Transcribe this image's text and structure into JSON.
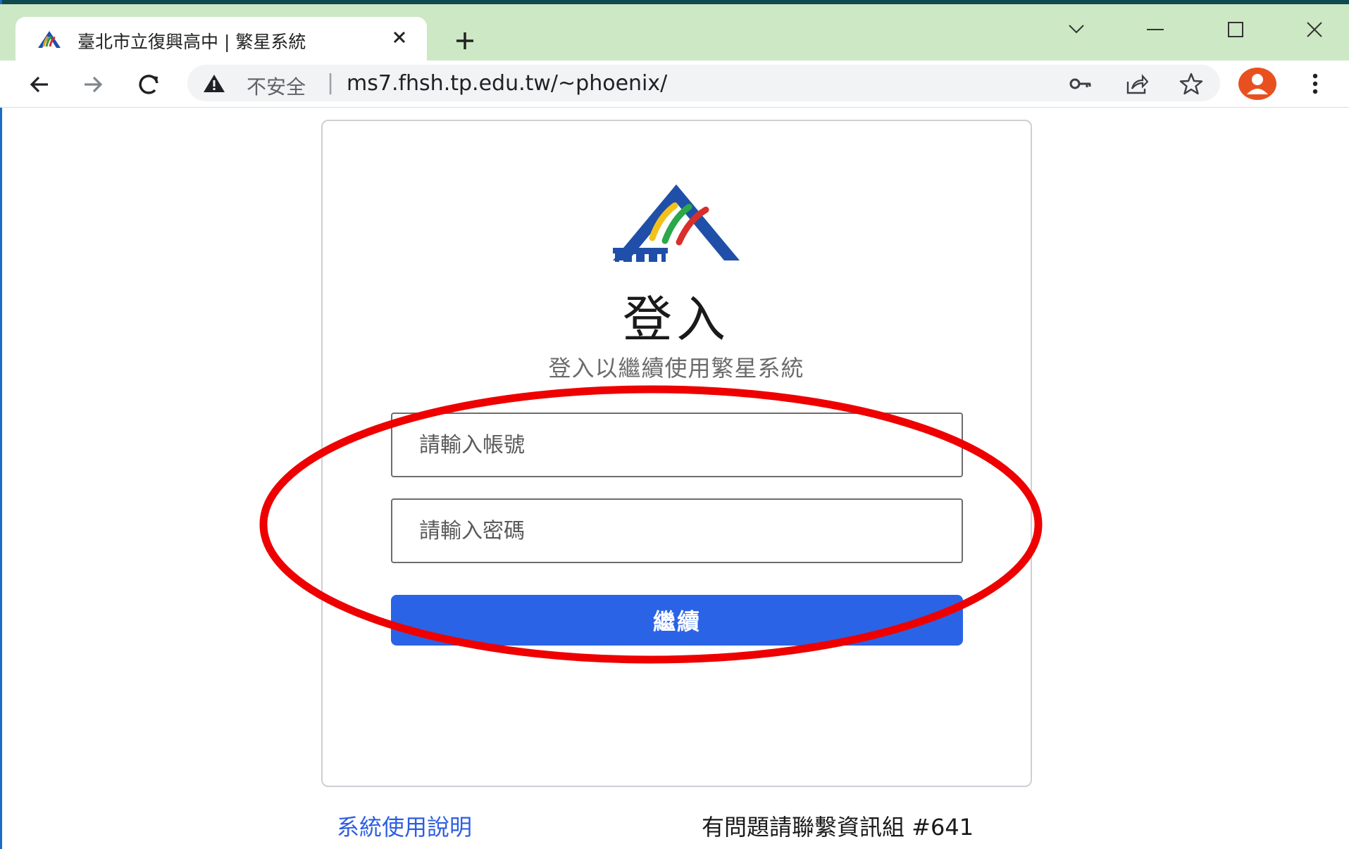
{
  "browser": {
    "tab": {
      "title": "臺北市立復興高中 | 繁星系統",
      "favicon": "school-logo-icon",
      "close_icon": "close-icon"
    },
    "new_tab_icon": "plus-icon",
    "window_controls": [
      "chevron-down-icon",
      "minimize-icon",
      "maximize-icon",
      "close-icon"
    ],
    "toolbar": {
      "back_icon": "arrow-left-icon",
      "forward_icon": "arrow-right-icon",
      "reload_icon": "reload-icon",
      "security_icon": "warning-triangle-icon",
      "security_label": "不安全",
      "separator": "|",
      "url": "ms7.fhsh.tp.edu.tw/~phoenix/",
      "right_icons": [
        "key-icon",
        "share-icon",
        "star-icon",
        "profile-avatar-icon",
        "kebab-menu-icon"
      ]
    }
  },
  "login": {
    "logo": "school-logo-icon",
    "title": "登入",
    "subtitle": "登入以繼續使用繁星系統",
    "account_placeholder": "請輸入帳號",
    "password_placeholder": "請輸入密碼",
    "submit_label": "繼續"
  },
  "annotation": {
    "shape": "ellipse",
    "color": "#ee0000"
  },
  "footer": {
    "help_link": "系統使用說明",
    "contact": "有問題請聯繫資訊組 #641"
  },
  "colors": {
    "tabstrip": "#cde8c4",
    "primary_button": "#2b63e6",
    "link": "#2c5ee0",
    "annotation": "#ee0000"
  }
}
